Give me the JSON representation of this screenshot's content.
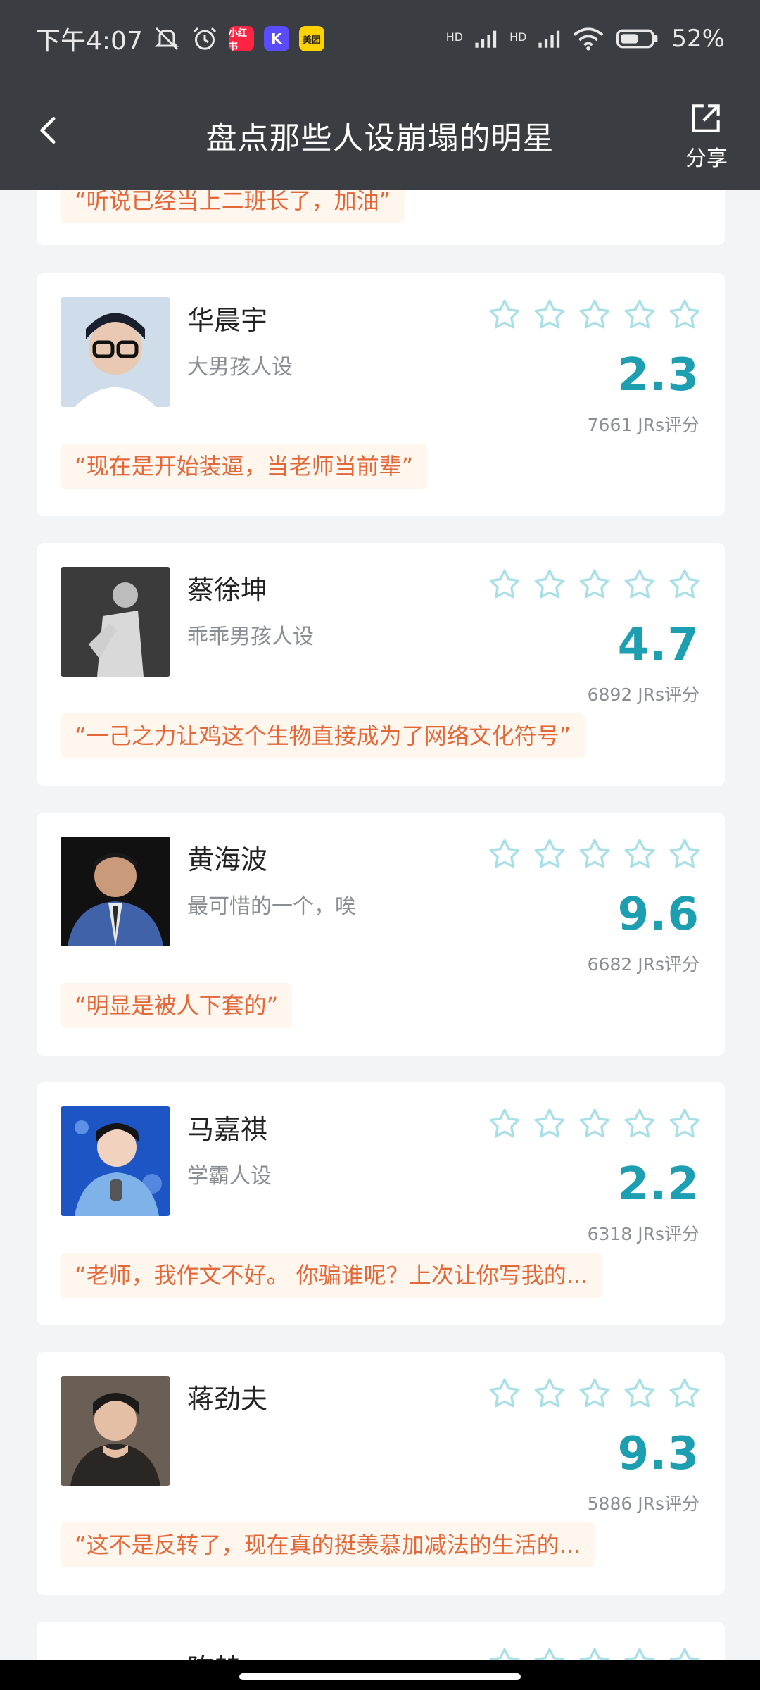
{
  "status_bar": {
    "time": "下午4:07",
    "app_badges": [
      {
        "label": "小红书",
        "color": "#ff2442"
      },
      {
        "label": "K",
        "color": "#5b4bff"
      },
      {
        "label": "美团",
        "color": "#ffd100"
      }
    ],
    "network_1": "HD",
    "network_2": "HD",
    "battery": "52%"
  },
  "nav": {
    "title": "盘点那些人设崩塌的明星",
    "share_label": "分享"
  },
  "partial_top_quote": "“听说已经当上二班长了，加油”",
  "cards": [
    {
      "name": "华晨宇",
      "tagline": "大男孩人设",
      "score": "2.3",
      "ratings": "7661 JRs评分",
      "quote": "“现在是开始装逼，当老师当前辈”",
      "avatar_color": "#5a7fa8"
    },
    {
      "name": "蔡徐坤",
      "tagline": "乖乖男孩人设",
      "score": "4.7",
      "ratings": "6892 JRs评分",
      "quote": "“一己之力让鸡这个生物直接成为了网络文化符号”",
      "avatar_color": "#7d7d7d"
    },
    {
      "name": "黄海波",
      "tagline": "最可惜的一个，唉",
      "score": "9.6",
      "ratings": "6682 JRs评分",
      "quote": "“明显是被人下套的”",
      "avatar_color": "#3f62a8"
    },
    {
      "name": "马嘉祺",
      "tagline": "学霸人设",
      "score": "2.2",
      "ratings": "6318 JRs评分",
      "quote": "“老师，我作文不好。 你骗谁呢？上次让你写我的...",
      "avatar_color": "#2b6fc9"
    },
    {
      "name": "蒋劲夫",
      "tagline": "",
      "score": "9.3",
      "ratings": "5886 JRs评分",
      "quote": "“这不是反转了，现在真的挺羡慕加减法的生活的...",
      "avatar_color": "#4a4340"
    },
    {
      "name": "陈赫",
      "tagline": "",
      "score": "",
      "ratings": "",
      "quote": "",
      "avatar_color": "#333333"
    }
  ],
  "colors": {
    "header_bg": "#3a3d42",
    "score": "#1d9fb1",
    "star_outline": "#a9dfe6",
    "quote_text": "#e2683a",
    "quote_bg": "#fff6ee"
  }
}
